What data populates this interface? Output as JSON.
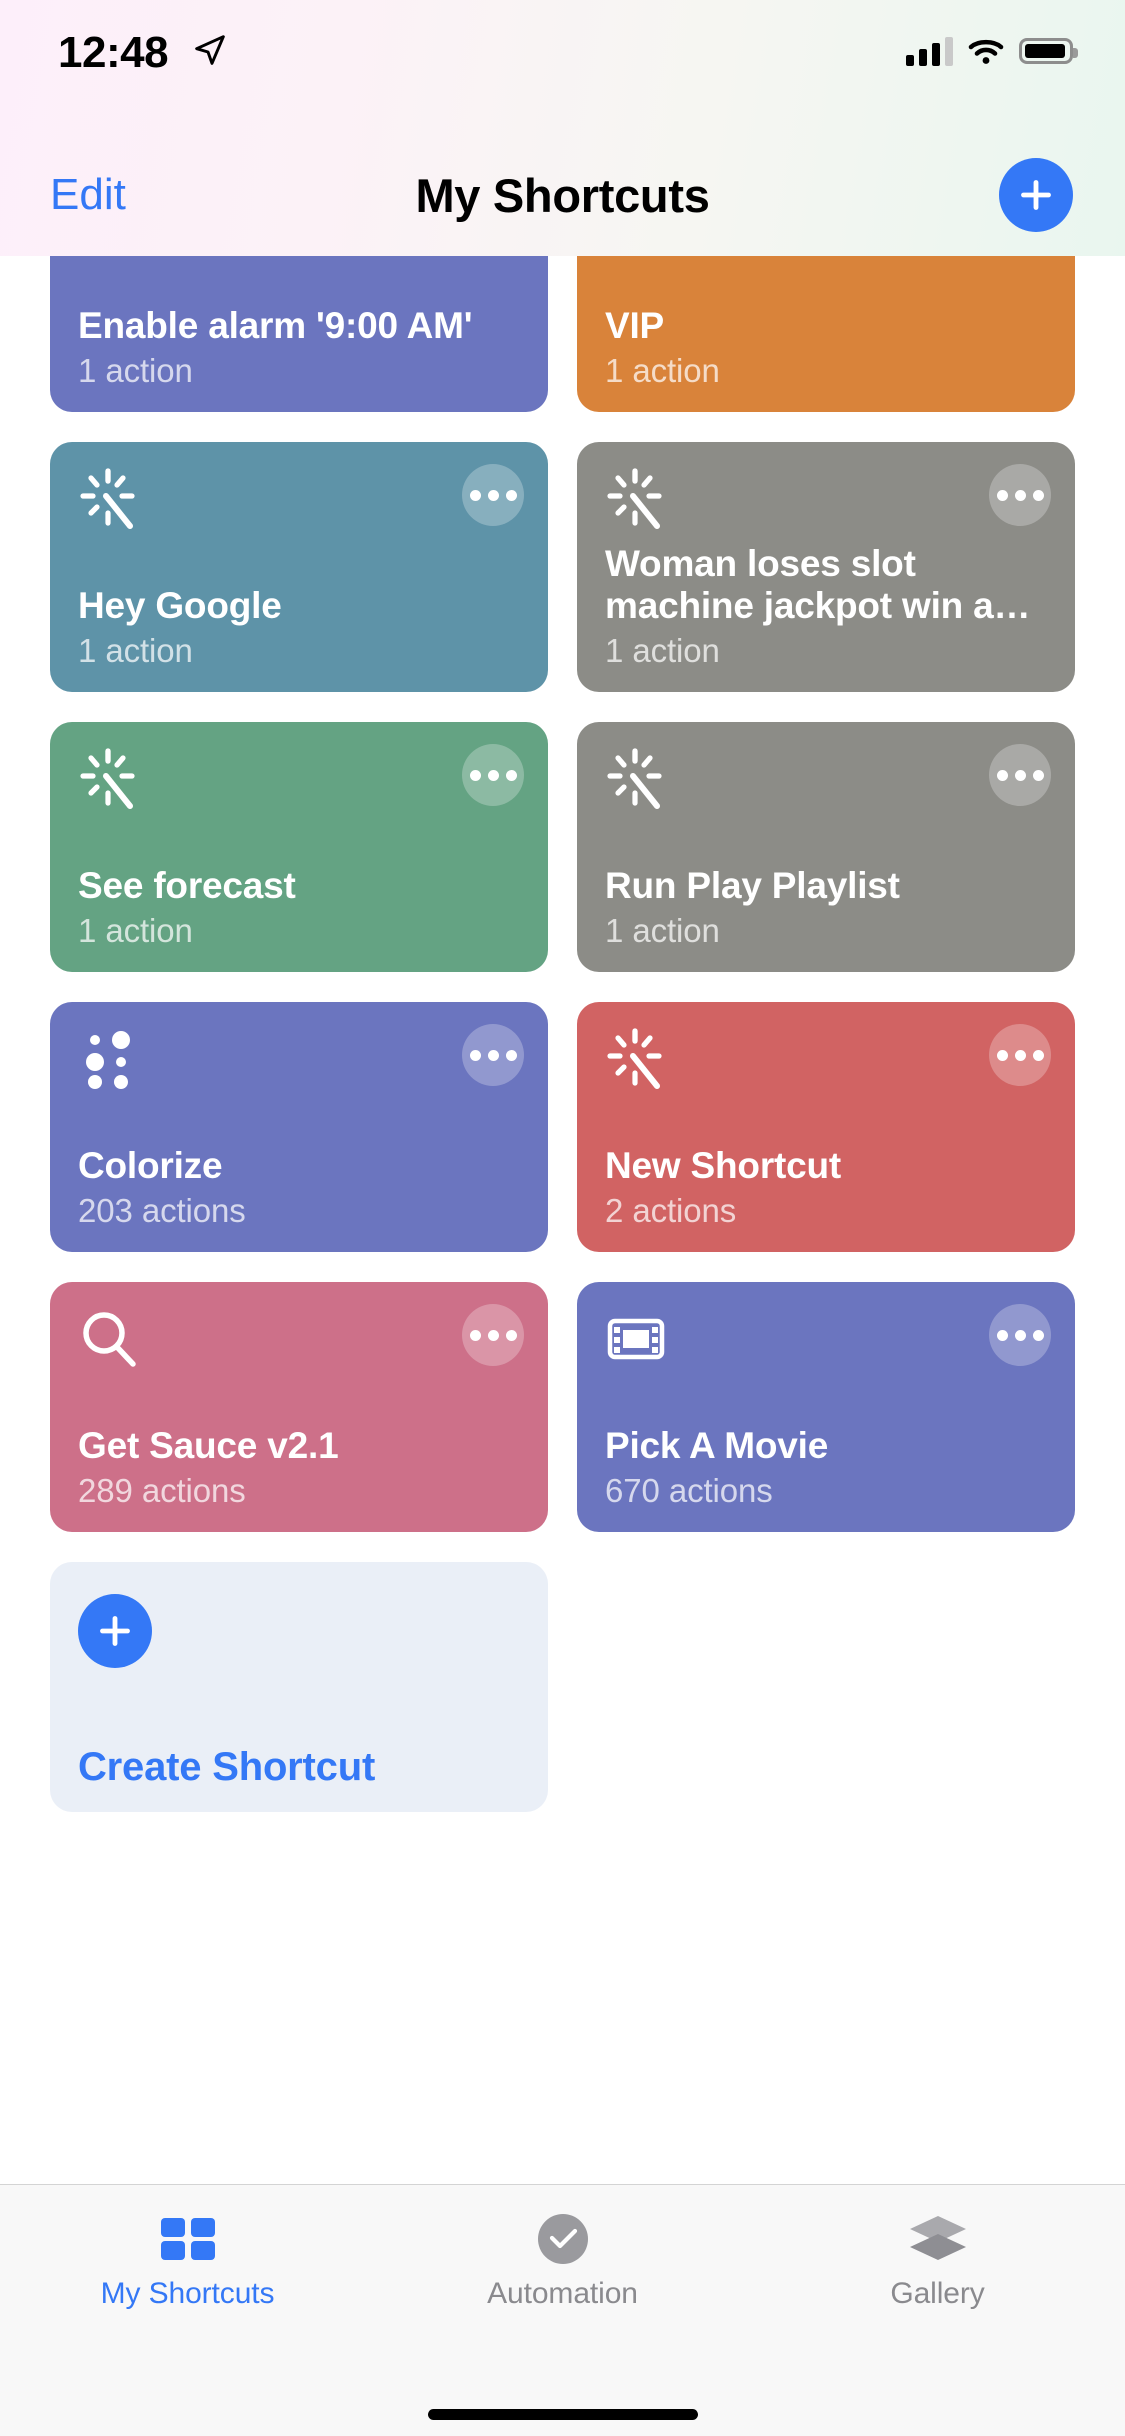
{
  "status_bar": {
    "time": "12:48",
    "location_icon": "location-arrow-icon",
    "cellular_icon": "cellular-signal-icon",
    "wifi_icon": "wifi-icon",
    "battery_icon": "battery-icon"
  },
  "nav": {
    "edit_label": "Edit",
    "title": "My Shortcuts",
    "add_icon": "plus-icon"
  },
  "colors": {
    "accent_blue": "#3478f6",
    "purple": "#6b75bf",
    "orange": "#d9833a",
    "teal": "#5e93a8",
    "gray": "#8c8c87",
    "green": "#64a383",
    "red": "#d16363",
    "pink": "#cd7089",
    "create_card_bg": "#eaeff7"
  },
  "shortcuts": [
    {
      "title": "Enable alarm '9:00 AM'",
      "subtitle": "1 action",
      "color": "#6b75bf",
      "icon": "magic-wand-icon"
    },
    {
      "title": "VIP",
      "subtitle": "1 action",
      "color": "#d9833a",
      "icon": "magic-wand-icon"
    },
    {
      "title": "Hey Google",
      "subtitle": "1 action",
      "color": "#5e93a8",
      "icon": "magic-wand-icon"
    },
    {
      "title": "Woman loses slot machine jackpot win a…",
      "subtitle": "1 action",
      "color": "#8c8c87",
      "icon": "magic-wand-icon"
    },
    {
      "title": "See forecast",
      "subtitle": "1 action",
      "color": "#64a383",
      "icon": "magic-wand-icon"
    },
    {
      "title": "Run Play Playlist",
      "subtitle": "1 action",
      "color": "#8c8c87",
      "icon": "magic-wand-icon"
    },
    {
      "title": "Colorize",
      "subtitle": "203 actions",
      "color": "#6b75bf",
      "icon": "halftone-dots-icon"
    },
    {
      "title": "New Shortcut",
      "subtitle": "2 actions",
      "color": "#d16363",
      "icon": "magic-wand-icon"
    },
    {
      "title": "Get Sauce v2.1",
      "subtitle": "289 actions",
      "color": "#cd7089",
      "icon": "search-icon"
    },
    {
      "title": "Pick A Movie",
      "subtitle": "670 actions",
      "color": "#6b75bf",
      "icon": "film-strip-icon"
    }
  ],
  "create_card": {
    "label": "Create Shortcut",
    "icon": "plus-icon"
  },
  "tabs": [
    {
      "label": "My Shortcuts",
      "icon": "grid-squares-icon",
      "active": true
    },
    {
      "label": "Automation",
      "icon": "clock-check-icon",
      "active": false
    },
    {
      "label": "Gallery",
      "icon": "layers-icon",
      "active": false
    }
  ],
  "card_more_icon": "ellipsis-icon"
}
